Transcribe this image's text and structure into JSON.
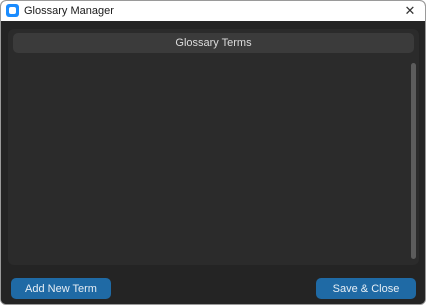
{
  "window": {
    "title": "Glossary Manager",
    "close_glyph": "✕",
    "app_icon": "app-icon"
  },
  "panel": {
    "header": "Glossary Terms",
    "terms": []
  },
  "buttons": {
    "add_label": "Add New Term",
    "save_label": "Save & Close"
  },
  "colors": {
    "background": "#242424",
    "panel": "#2b2b2b",
    "header": "#3b3b3b",
    "accent": "#1f6aa5"
  }
}
